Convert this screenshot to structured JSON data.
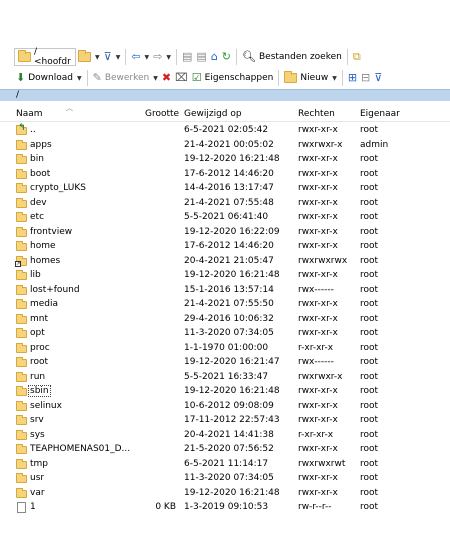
{
  "toolbar1": {
    "path_label": "/ <hoofdr",
    "find_files_label": "Bestanden zoeken"
  },
  "toolbar2": {
    "download_label": "Download",
    "edit_label": "Bewerken",
    "properties_label": "Eigenschappen",
    "new_label": "Nieuw"
  },
  "address": {
    "path": "/"
  },
  "columns": {
    "name": "Naam",
    "size": "Grootte",
    "modified": "Gewijzigd op",
    "rights": "Rechten",
    "owner": "Eigenaar"
  },
  "files": [
    {
      "name": "..",
      "size": "",
      "modified": "6-5-2021 02:05:42",
      "rights": "rwxr-xr-x",
      "owner": "root",
      "kind": "parent"
    },
    {
      "name": "apps",
      "size": "",
      "modified": "21-4-2021 00:05:02",
      "rights": "rwxrwxr-x",
      "owner": "admin",
      "kind": "folder"
    },
    {
      "name": "bin",
      "size": "",
      "modified": "19-12-2020 16:21:48",
      "rights": "rwxr-xr-x",
      "owner": "root",
      "kind": "folder"
    },
    {
      "name": "boot",
      "size": "",
      "modified": "17-6-2012 14:46:20",
      "rights": "rwxr-xr-x",
      "owner": "root",
      "kind": "folder"
    },
    {
      "name": "crypto_LUKS",
      "size": "",
      "modified": "14-4-2016 13:17:47",
      "rights": "rwxr-xr-x",
      "owner": "root",
      "kind": "folder"
    },
    {
      "name": "dev",
      "size": "",
      "modified": "21-4-2021 07:55:48",
      "rights": "rwxr-xr-x",
      "owner": "root",
      "kind": "folder"
    },
    {
      "name": "etc",
      "size": "",
      "modified": "5-5-2021 06:41:40",
      "rights": "rwxr-xr-x",
      "owner": "root",
      "kind": "folder"
    },
    {
      "name": "frontview",
      "size": "",
      "modified": "19-12-2020 16:22:09",
      "rights": "rwxr-xr-x",
      "owner": "root",
      "kind": "folder"
    },
    {
      "name": "home",
      "size": "",
      "modified": "17-6-2012 14:46:20",
      "rights": "rwxr-xr-x",
      "owner": "root",
      "kind": "folder"
    },
    {
      "name": "homes",
      "size": "",
      "modified": "20-4-2021 21:05:47",
      "rights": "rwxrwxrwx",
      "owner": "root",
      "kind": "link"
    },
    {
      "name": "lib",
      "size": "",
      "modified": "19-12-2020 16:21:48",
      "rights": "rwxr-xr-x",
      "owner": "root",
      "kind": "folder"
    },
    {
      "name": "lost+found",
      "size": "",
      "modified": "15-1-2016 13:57:14",
      "rights": "rwx------",
      "owner": "root",
      "kind": "folder"
    },
    {
      "name": "media",
      "size": "",
      "modified": "21-4-2021 07:55:50",
      "rights": "rwxr-xr-x",
      "owner": "root",
      "kind": "folder"
    },
    {
      "name": "mnt",
      "size": "",
      "modified": "29-4-2016 10:06:32",
      "rights": "rwxr-xr-x",
      "owner": "root",
      "kind": "folder"
    },
    {
      "name": "opt",
      "size": "",
      "modified": "11-3-2020 07:34:05",
      "rights": "rwxr-xr-x",
      "owner": "root",
      "kind": "folder"
    },
    {
      "name": "proc",
      "size": "",
      "modified": "1-1-1970 01:00:00",
      "rights": "r-xr-xr-x",
      "owner": "root",
      "kind": "folder"
    },
    {
      "name": "root",
      "size": "",
      "modified": "19-12-2020 16:21:47",
      "rights": "rwx------",
      "owner": "root",
      "kind": "folder"
    },
    {
      "name": "run",
      "size": "",
      "modified": "5-5-2021 16:33:47",
      "rights": "rwxrwxr-x",
      "owner": "root",
      "kind": "folder"
    },
    {
      "name": "sbin",
      "size": "",
      "modified": "19-12-2020 16:21:48",
      "rights": "rwxr-xr-x",
      "owner": "root",
      "kind": "folder",
      "focused": true
    },
    {
      "name": "selinux",
      "size": "",
      "modified": "10-6-2012 09:08:09",
      "rights": "rwxr-xr-x",
      "owner": "root",
      "kind": "folder"
    },
    {
      "name": "srv",
      "size": "",
      "modified": "17-11-2012 22:57:43",
      "rights": "rwxr-xr-x",
      "owner": "root",
      "kind": "folder"
    },
    {
      "name": "sys",
      "size": "",
      "modified": "20-4-2021 14:41:38",
      "rights": "r-xr-xr-x",
      "owner": "root",
      "kind": "folder"
    },
    {
      "name": "TEAPHOMENAS01_D...",
      "size": "",
      "modified": "21-5-2020 07:56:52",
      "rights": "rwxr-xr-x",
      "owner": "root",
      "kind": "folder"
    },
    {
      "name": "tmp",
      "size": "",
      "modified": "6-5-2021 11:14:17",
      "rights": "rwxrwxrwt",
      "owner": "root",
      "kind": "folder"
    },
    {
      "name": "usr",
      "size": "",
      "modified": "11-3-2020 07:34:05",
      "rights": "rwxr-xr-x",
      "owner": "root",
      "kind": "folder"
    },
    {
      "name": "var",
      "size": "",
      "modified": "19-12-2020 16:21:48",
      "rights": "rwxr-xr-x",
      "owner": "root",
      "kind": "folder"
    },
    {
      "name": "1",
      "size": "0 KB",
      "modified": "1-3-2019 09:10:53",
      "rights": "rw-r--r--",
      "owner": "root",
      "kind": "file"
    }
  ],
  "icons": {
    "folder": "folder-icon",
    "parent": "parent-folder-icon",
    "link": "folder-link-icon",
    "file": "file-icon"
  },
  "colors": {
    "address_bar": "#bcd5ec",
    "folder": "#f6d47c"
  }
}
